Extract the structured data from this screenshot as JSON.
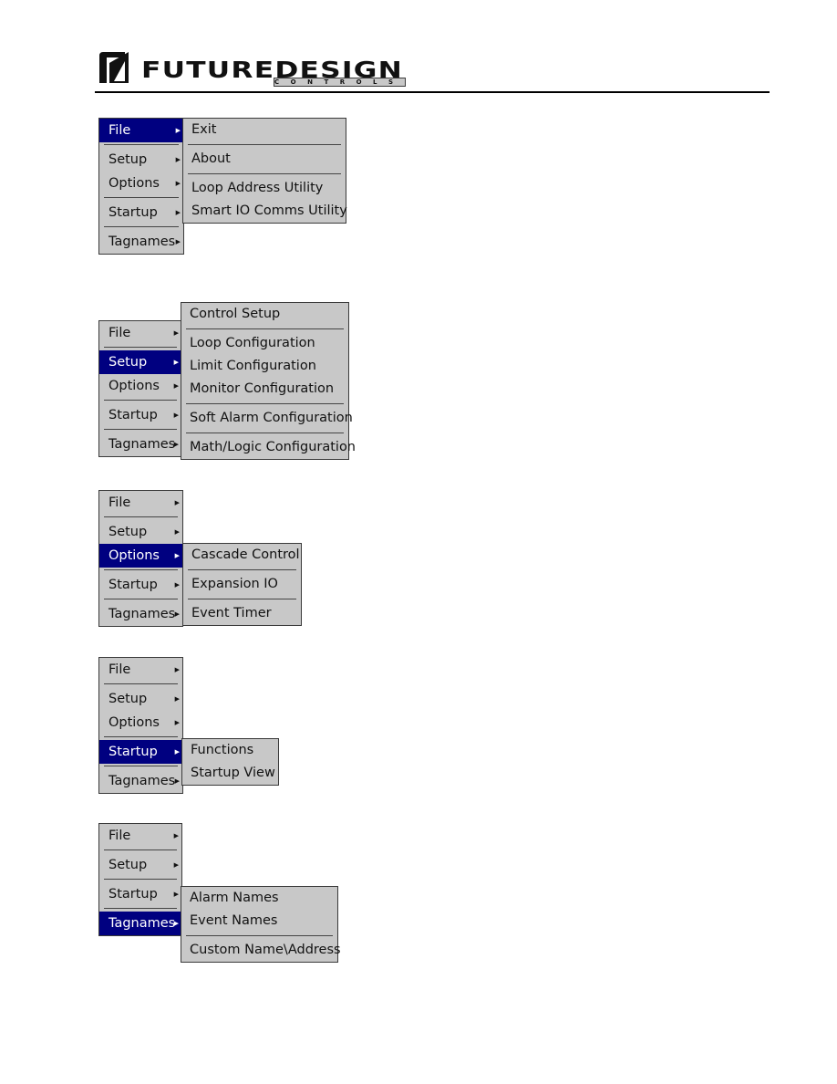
{
  "header": {
    "brand": "FUTUREDESIGN",
    "subbrand": "CONTROLS"
  },
  "colors": {
    "highlight": "#000080",
    "menu_bg": "#c8c8c8"
  },
  "menus": [
    {
      "main": [
        {
          "label": "File",
          "selected": true
        },
        {
          "sep": true
        },
        {
          "label": "Setup"
        },
        {
          "label": "Options"
        },
        {
          "sep": true
        },
        {
          "label": "Startup"
        },
        {
          "sep": true
        },
        {
          "label": "Tagnames"
        }
      ],
      "sub": [
        {
          "label": "Exit"
        },
        {
          "sep": true
        },
        {
          "label": "About"
        },
        {
          "sep": true
        },
        {
          "label": "Loop Address Utility"
        },
        {
          "label": "Smart IO Comms Utility"
        }
      ]
    },
    {
      "main": [
        {
          "label": "File"
        },
        {
          "sep": true
        },
        {
          "label": "Setup",
          "selected": true
        },
        {
          "label": "Options"
        },
        {
          "sep": true
        },
        {
          "label": "Startup"
        },
        {
          "sep": true
        },
        {
          "label": "Tagnames"
        }
      ],
      "sub": [
        {
          "label": "Control Setup"
        },
        {
          "sep": true
        },
        {
          "label": "Loop Configuration"
        },
        {
          "label": "Limit Configuration"
        },
        {
          "label": "Monitor Configuration"
        },
        {
          "sep": true
        },
        {
          "label": "Soft Alarm Configuration"
        },
        {
          "sep": true
        },
        {
          "label": "Math/Logic Configuration"
        }
      ]
    },
    {
      "main": [
        {
          "label": "File"
        },
        {
          "sep": true
        },
        {
          "label": "Setup"
        },
        {
          "label": "Options",
          "selected": true
        },
        {
          "sep": true
        },
        {
          "label": "Startup"
        },
        {
          "sep": true
        },
        {
          "label": "Tagnames"
        }
      ],
      "sub": [
        {
          "label": "Cascade Control"
        },
        {
          "sep": true
        },
        {
          "label": "Expansion IO"
        },
        {
          "sep": true
        },
        {
          "label": "Event Timer"
        }
      ]
    },
    {
      "main": [
        {
          "label": "File"
        },
        {
          "sep": true
        },
        {
          "label": "Setup"
        },
        {
          "label": "Options"
        },
        {
          "sep": true
        },
        {
          "label": "Startup",
          "selected": true
        },
        {
          "sep": true
        },
        {
          "label": "Tagnames"
        }
      ],
      "sub": [
        {
          "label": "Functions"
        },
        {
          "label": "Startup View"
        }
      ]
    },
    {
      "main": [
        {
          "label": "File"
        },
        {
          "sep": true
        },
        {
          "label": "Setup"
        },
        {
          "sep": true
        },
        {
          "label": "Startup"
        },
        {
          "sep": true
        },
        {
          "label": "Tagnames",
          "selected": true
        }
      ],
      "sub": [
        {
          "label": "Alarm Names"
        },
        {
          "label": "Event Names"
        },
        {
          "sep": true
        },
        {
          "label": "Custom Name\\Address"
        }
      ]
    }
  ]
}
